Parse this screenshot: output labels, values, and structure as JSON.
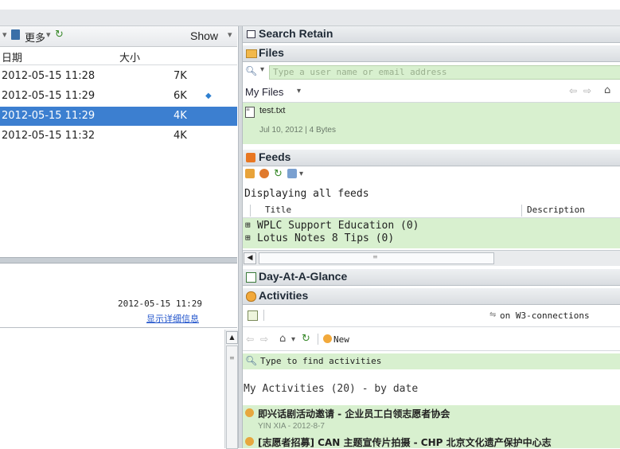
{
  "left": {
    "toolbar": {
      "more_label": "更多",
      "show_label": "Show"
    },
    "columns": {
      "date": "日期",
      "size": "大小"
    },
    "rows": [
      {
        "date": "2012-05-15 11:28",
        "size": "7K"
      },
      {
        "date": "2012-05-15 11:29",
        "size": "6K"
      },
      {
        "date": "2012-05-15 11:29",
        "size": "4K"
      },
      {
        "date": "2012-05-15 11:32",
        "size": "4K"
      }
    ],
    "detail": {
      "timestamp": "2012-05-15 11:29",
      "link": "显示详细信息"
    }
  },
  "right": {
    "search_retain": {
      "title": "Search Retain"
    },
    "files": {
      "title": "Files",
      "search_placeholder": "Type a user name or email address",
      "my_files": "My Files",
      "file_name": "test.txt",
      "file_meta": "Jul 10, 2012  |  4 Bytes"
    },
    "feeds": {
      "title": "Feeds",
      "displaying": "Displaying all feeds",
      "col_title": "Title",
      "col_desc": "Description",
      "items": [
        "WPLC Support Education (0)",
        "Lotus Notes 8 Tips (0)"
      ]
    },
    "day_at_a_glance": {
      "title": "Day-At-A-Glance"
    },
    "activities": {
      "title": "Activities",
      "connection": "on W3-connections",
      "new_label": "New",
      "search_placeholder": "Type to find activities",
      "heading": "My Activities (20) - by date",
      "items": [
        {
          "title": "即兴话剧活动邀请 - 企业员工白领志愿者协会",
          "meta": "YIN XIA - 2012-8-7"
        },
        {
          "title": "[志愿者招募] CAN 主题宣传片拍摄 - CHP 北京文化遗产保护中心志",
          "meta": ""
        }
      ]
    }
  }
}
